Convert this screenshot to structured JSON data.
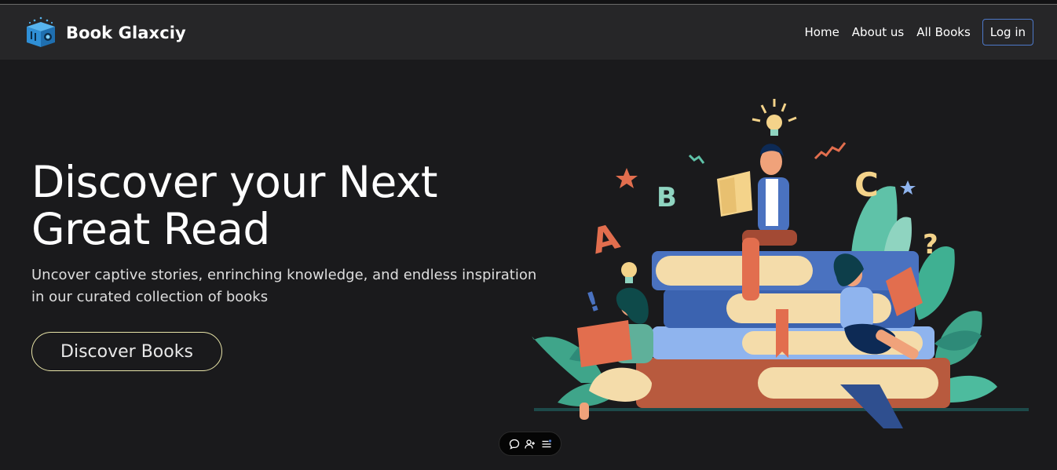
{
  "navbar": {
    "brand_name": "Book Glaxciy",
    "links": [
      "Home",
      "About us",
      "All Books"
    ],
    "login_label": "Log in"
  },
  "hero": {
    "title_line1": "Discover your Next",
    "title_line2": "Great Read",
    "subtitle_line1": "Uncover captive stories, enrinching knowledge, and endless inspiration",
    "subtitle_line2": "in our curated collection of books",
    "cta_label": "Discover Books"
  },
  "illustration": {
    "letters": [
      "A",
      "B",
      "C",
      "?",
      "!"
    ]
  },
  "toolbar": {
    "icons": [
      "comment-icon",
      "add-user-icon",
      "list-settings-icon"
    ]
  },
  "colors": {
    "background": "#1a1a1c",
    "navbar": "#262628",
    "login_border": "#4d78c8",
    "cta_border": "#e8e4a8"
  }
}
